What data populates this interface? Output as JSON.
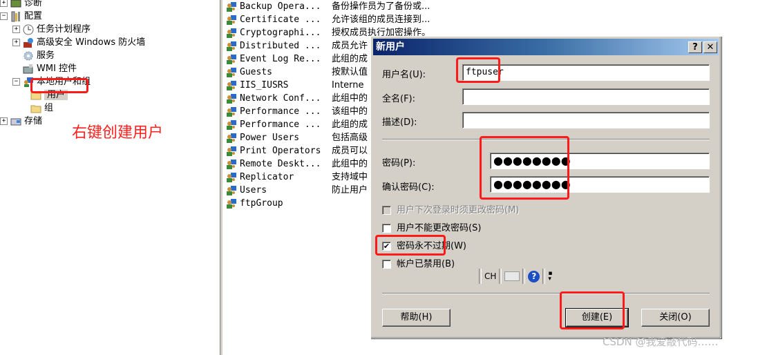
{
  "tree": {
    "items": [
      {
        "label": "诊断",
        "expander": "+",
        "icon": "diagnostics-icon",
        "level": 0
      },
      {
        "label": "配置",
        "expander": "−",
        "icon": "configuration-icon",
        "level": 0
      },
      {
        "label": "任务计划程序",
        "expander": "+",
        "icon": "clock-icon",
        "level": 1
      },
      {
        "label": "高级安全 Windows 防火墙",
        "expander": "+",
        "icon": "firewall-icon",
        "level": 1
      },
      {
        "label": "服务",
        "expander": "",
        "icon": "gear-icon",
        "level": 1
      },
      {
        "label": "WMI 控件",
        "expander": "",
        "icon": "wmi-icon",
        "level": 1
      },
      {
        "label": "本地用户和组",
        "expander": "−",
        "icon": "users-computer-icon",
        "level": 1
      },
      {
        "label": "用户",
        "expander": "",
        "icon": "folder-icon",
        "level": 2,
        "selected": true
      },
      {
        "label": "组",
        "expander": "",
        "icon": "folder-icon",
        "level": 2
      },
      {
        "label": "存储",
        "expander": "+",
        "icon": "storage-icon",
        "level": 0
      }
    ]
  },
  "annotation": "右键创建用户",
  "groups": [
    {
      "name": "Backup Opera...",
      "desc": "备份操作员为了备份或..."
    },
    {
      "name": "Certificate ...",
      "desc": "允许该组的成员连接到..."
    },
    {
      "name": "Cryptographi...",
      "desc": "授权成员执行加密操作。"
    },
    {
      "name": "Distributed ...",
      "desc": "成员允许"
    },
    {
      "name": "Event Log Re...",
      "desc": "此组的成"
    },
    {
      "name": "Guests",
      "desc": "按默认值"
    },
    {
      "name": "IIS_IUSRS",
      "desc": "Interne"
    },
    {
      "name": "Network Conf...",
      "desc": "此组中的"
    },
    {
      "name": "Performance ...",
      "desc": "该组中的"
    },
    {
      "name": "Performance ...",
      "desc": "此组的成"
    },
    {
      "name": "Power Users",
      "desc": "包括高级"
    },
    {
      "name": "Print Operators",
      "desc": "成员可以"
    },
    {
      "name": "Remote Deskt...",
      "desc": "此组中的"
    },
    {
      "name": "Replicator",
      "desc": "支持域中"
    },
    {
      "name": "Users",
      "desc": "防止用户"
    },
    {
      "name": "ftpGroup",
      "desc": ""
    }
  ],
  "dialog": {
    "title": "新用户",
    "help_btn": "?",
    "close_btn": "✕",
    "username_label": "用户名(U):",
    "username_value": "ftpuser",
    "fullname_label": "全名(F):",
    "fullname_value": "",
    "desc_label": "描述(D):",
    "desc_value": "",
    "password_label": "密码(P):",
    "password_mask": "●●●●●●●●",
    "confirm_label": "确认密码(C):",
    "confirm_mask": "●●●●●●●●",
    "checkboxes": [
      {
        "label": "用户下次登录时须更改密码(M)",
        "checked": false,
        "disabled": true
      },
      {
        "label": "用户不能更改密码(S)",
        "checked": false,
        "disabled": false
      },
      {
        "label": "密码永不过期(W)",
        "checked": true,
        "disabled": false
      },
      {
        "label": "帐户已禁用(B)",
        "checked": false,
        "disabled": false
      }
    ],
    "langbar": {
      "lang": "CH"
    },
    "buttons": {
      "help": "帮助(H)",
      "create": "创建(E)",
      "close": "关闭(O)"
    }
  },
  "watermark": "CSDN @我爱敲代码……"
}
